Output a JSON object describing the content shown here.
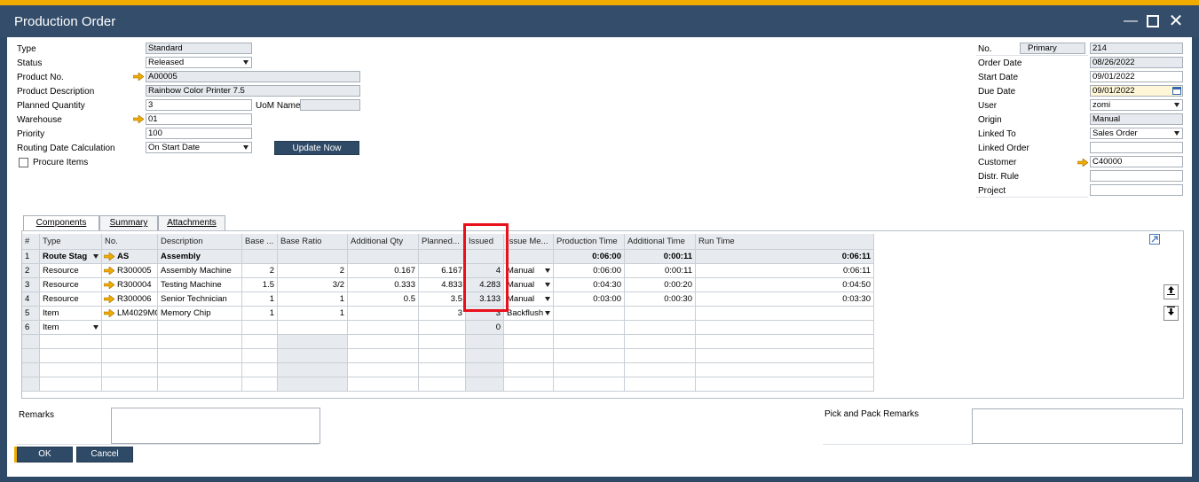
{
  "window": {
    "title": "Production Order"
  },
  "left_form": {
    "type_label": "Type",
    "type_value": "Standard",
    "status_label": "Status",
    "status_value": "Released",
    "product_no_label": "Product No.",
    "product_no_value": "A00005",
    "product_desc_label": "Product Description",
    "product_desc_value": "Rainbow Color Printer 7.5",
    "planned_qty_label": "Planned Quantity",
    "planned_qty_value": "3",
    "uom_label": "UoM Name",
    "uom_value": "",
    "warehouse_label": "Warehouse",
    "warehouse_value": "01",
    "priority_label": "Priority",
    "priority_value": "100",
    "routing_label": "Routing Date Calculation",
    "routing_value": "On Start Date",
    "update_now": "Update Now",
    "procure_items": "Procure Items"
  },
  "right_form": {
    "no_label": "No.",
    "series_value": "Primary",
    "no_value": "214",
    "order_date_label": "Order Date",
    "order_date_value": "08/26/2022",
    "start_date_label": "Start Date",
    "start_date_value": "09/01/2022",
    "due_date_label": "Due Date",
    "due_date_value": "09/01/2022",
    "user_label": "User",
    "user_value": "zomi",
    "origin_label": "Origin",
    "origin_value": "Manual",
    "linked_to_label": "Linked To",
    "linked_to_value": "Sales Order",
    "linked_order_label": "Linked Order",
    "linked_order_value": "",
    "customer_label": "Customer",
    "customer_value": "C40000",
    "distr_rule_label": "Distr. Rule",
    "distr_rule_value": "",
    "project_label": "Project",
    "project_value": ""
  },
  "tabs": [
    "Components",
    "Summary",
    "Attachments"
  ],
  "grid": {
    "columns": [
      "#",
      "Type",
      "No.",
      "Description",
      "Base ...",
      "Base Ratio",
      "Additional Qty",
      "Planned...",
      "Issued",
      "Issue Me...",
      "Production Time",
      "Additional Time",
      "Run Time"
    ],
    "rows": [
      [
        "1",
        "Route Stag",
        "AS",
        "Assembly",
        "",
        "",
        "",
        "",
        "",
        "",
        "0:06:00",
        "0:00:11",
        "0:06:11"
      ],
      [
        "2",
        "Resource",
        "R300005",
        "Assembly Machine",
        "2",
        "2",
        "0.167",
        "6.167",
        "4",
        "Manual",
        "0:06:00",
        "0:00:11",
        "0:06:11"
      ],
      [
        "3",
        "Resource",
        "R300004",
        "Testing Machine",
        "1.5",
        "3/2",
        "0.333",
        "4.833",
        "4.283",
        "Manual",
        "0:04:30",
        "0:00:20",
        "0:04:50"
      ],
      [
        "4",
        "Resource",
        "R300006",
        "Senior Technician",
        "1",
        "1",
        "0.5",
        "3.5",
        "3.133",
        "Manual",
        "0:03:00",
        "0:00:30",
        "0:03:30"
      ],
      [
        "5",
        "Item",
        "LM4029MC",
        "Memory Chip",
        "1",
        "1",
        "",
        "3",
        "3",
        "Backflush",
        "",
        "",
        ""
      ],
      [
        "6",
        "Item",
        "",
        "",
        "",
        "",
        "",
        "",
        "0",
        "",
        "",
        "",
        ""
      ]
    ]
  },
  "footer": {
    "remarks_label": "Remarks",
    "pick_pack_label": "Pick and Pack Remarks",
    "ok": "OK",
    "cancel": "Cancel"
  },
  "colors": {
    "accent": "#f0ab00",
    "titlebar": "#334d6b",
    "highlight": "#e8101b"
  }
}
